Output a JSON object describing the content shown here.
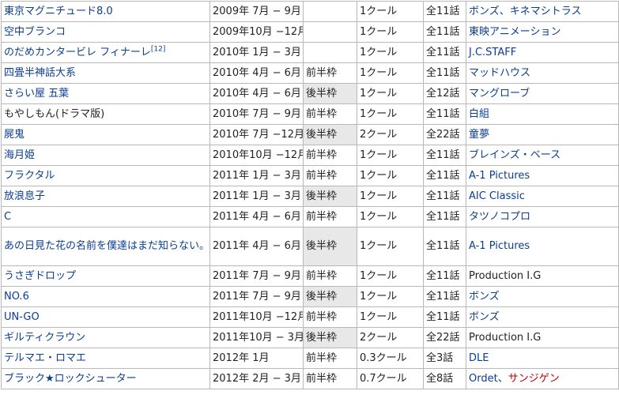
{
  "rows": [
    {
      "title": "東京マグニチュード8.0",
      "period": "2009年 7月 − 9月",
      "slot": "",
      "length": "1クール",
      "episodes": "全11話",
      "studio": "ボンズ、キネマシトラス"
    },
    {
      "title": "空中ブランコ",
      "period": "2009年10月 −12月",
      "slot": "",
      "length": "1クール",
      "episodes": "全11話",
      "studio": "東映アニメーション"
    },
    {
      "title": "のだめカンタービレ フィナーレ",
      "note": "[12]",
      "period": "2010年 1月 − 3月",
      "slot": "",
      "length": "1クール",
      "episodes": "全11話",
      "studio": "J.C.STAFF"
    },
    {
      "title": "四畳半神話大系",
      "period": "2010年 4月 − 6月",
      "slot": "前半枠",
      "length": "1クール",
      "episodes": "全11話",
      "studio": "マッドハウス"
    },
    {
      "title": "さらい屋 五葉",
      "period": "2010年 4月 − 6月",
      "slot": "後半枠",
      "length": "1クール",
      "episodes": "全12話",
      "studio": "マングローブ"
    },
    {
      "title": "もやしもん(ドラマ版)",
      "period": "2010年 7月 − 9月",
      "slot": "前半枠",
      "length": "1クール",
      "episodes": "全11話",
      "studio": "白組"
    },
    {
      "title": "屍鬼",
      "period": "2010年 7月 −12月",
      "slot": "後半枠",
      "length": "2クール",
      "episodes": "全22話",
      "studio": "童夢"
    },
    {
      "title": "海月姫",
      "period": "2010年10月 −12月",
      "slot": "前半枠",
      "length": "1クール",
      "episodes": "全11話",
      "studio": "ブレインズ・ベース"
    },
    {
      "title": "フラクタル",
      "period": "2011年 1月 − 3月",
      "slot": "前半枠",
      "length": "1クール",
      "episodes": "全11話",
      "studio": "A-1 Pictures"
    },
    {
      "title": "放浪息子",
      "period": "2011年 1月 − 3月",
      "slot": "後半枠",
      "length": "1クール",
      "episodes": "全11話",
      "studio": "AIC Classic"
    },
    {
      "title": "C",
      "period": "2011年 4月 − 6月",
      "slot": "前半枠",
      "length": "1クール",
      "episodes": "全11話",
      "studio": "タツノコプロ"
    },
    {
      "title": "あの日見た花の名前を僕達はまだ知らない。",
      "period": "2011年 4月 − 6月",
      "slot": "後半枠",
      "length": "1クール",
      "episodes": "全11話",
      "studio": "A-1 Pictures"
    },
    {
      "title": "うさぎドロップ",
      "period": "2011年 7月 − 9月",
      "slot": "前半枠",
      "length": "1クール",
      "episodes": "全11話",
      "studio": "Production I.G"
    },
    {
      "title": "NO.6",
      "period": "2011年 7月 − 9月",
      "slot": "後半枠",
      "length": "1クール",
      "episodes": "全11話",
      "studio": "ボンズ"
    },
    {
      "title": "UN-GO",
      "period": "2011年10月 −12月",
      "slot": "前半枠",
      "length": "1クール",
      "episodes": "全11話",
      "studio": "ボンズ"
    },
    {
      "title": "ギルティクラウン",
      "period": "2011年10月 − 3月",
      "slot": "後半枠",
      "length": "2クール",
      "episodes": "全22話",
      "studio": "Production I.G"
    },
    {
      "title": "テルマエ・ロマエ",
      "period": "2012年 1月",
      "slot": "前半枠",
      "length": "0.3クール",
      "episodes": "全3話",
      "studio": "DLE"
    },
    {
      "title": "ブラック★ロックシューター",
      "period": "2012年 2月 − 3月",
      "slot": "前半枠",
      "length": "0.7クール",
      "episodes": "全8話",
      "studio": "Ordet、",
      "studio2": "サンジゲン"
    }
  ],
  "colors": {
    "link": "#0b3d91",
    "redlink": "#ba0000",
    "late_slot_bg": "#e8e8e8",
    "border": "#b8b8b8"
  }
}
